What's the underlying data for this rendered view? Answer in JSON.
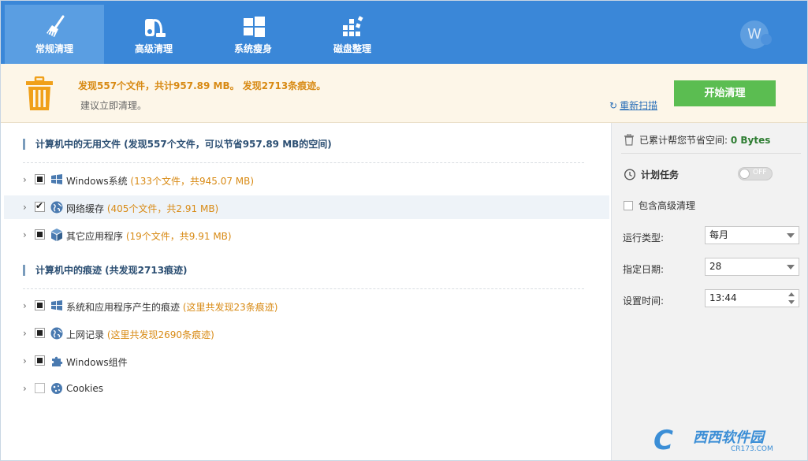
{
  "header": {
    "tabs": [
      {
        "label": "常规清理",
        "icon": "broom-icon",
        "active": true
      },
      {
        "label": "高级清理",
        "icon": "vacuum-icon",
        "active": false
      },
      {
        "label": "系统瘦身",
        "icon": "windows-icon",
        "active": false
      },
      {
        "label": "磁盘整理",
        "icon": "defrag-icon",
        "active": false
      }
    ],
    "avatar_letter": "W"
  },
  "banner": {
    "message": "发现557个文件，共计957.89 MB。 发现2713条痕迹。",
    "sub": "建议立即清理。",
    "rescan": "重新扫描",
    "start_button": "开始清理"
  },
  "sections": [
    {
      "title": "计算机中的无用文件 (发现557个文件，可以节省957.89 MB的空间)",
      "items": [
        {
          "label": "Windows系统",
          "detail": "(133个文件，共945.07 MB)",
          "check": "partial",
          "icon": "windows-icon",
          "highlight": false
        },
        {
          "label": "网络缓存",
          "detail": "(405个文件，共2.91 MB)",
          "check": "checked",
          "icon": "globe-icon",
          "highlight": true
        },
        {
          "label": "其它应用程序",
          "detail": "(19个文件，共9.91 MB)",
          "check": "partial",
          "icon": "cube-icon",
          "highlight": false
        }
      ]
    },
    {
      "title": "计算机中的痕迹 (共发现2713痕迹)",
      "items": [
        {
          "label": "系统和应用程序产生的痕迹",
          "detail": "(这里共发现23条痕迹)",
          "check": "partial",
          "icon": "windows-icon",
          "highlight": false
        },
        {
          "label": "上网记录",
          "detail": "(这里共发现2690条痕迹)",
          "check": "partial",
          "icon": "globe-icon",
          "highlight": false
        },
        {
          "label": "Windows组件",
          "detail": "",
          "check": "partial",
          "icon": "puzzle-icon",
          "highlight": false
        },
        {
          "label": "Cookies",
          "detail": "",
          "check": "none",
          "icon": "cookie-icon",
          "highlight": false
        }
      ]
    }
  ],
  "side": {
    "saved_label": "已累计帮您节省空间:",
    "saved_value": "0 Bytes",
    "schedule_label": "计划任务",
    "toggle_text": "OFF",
    "advanced_label": "包含高级清理",
    "run_type_label": "运行类型:",
    "run_type_value": "每月",
    "date_label": "指定日期:",
    "date_value": "28",
    "time_label": "设置时间:",
    "time_value": "13:44"
  },
  "watermark": {
    "text": "西西软件园",
    "sub": "CR173.COM"
  },
  "colors": {
    "header_bg": "#3a87d8",
    "banner_bg": "#fdf6e8",
    "accent_orange": "#d88a14",
    "start_green": "#5bbd51"
  }
}
